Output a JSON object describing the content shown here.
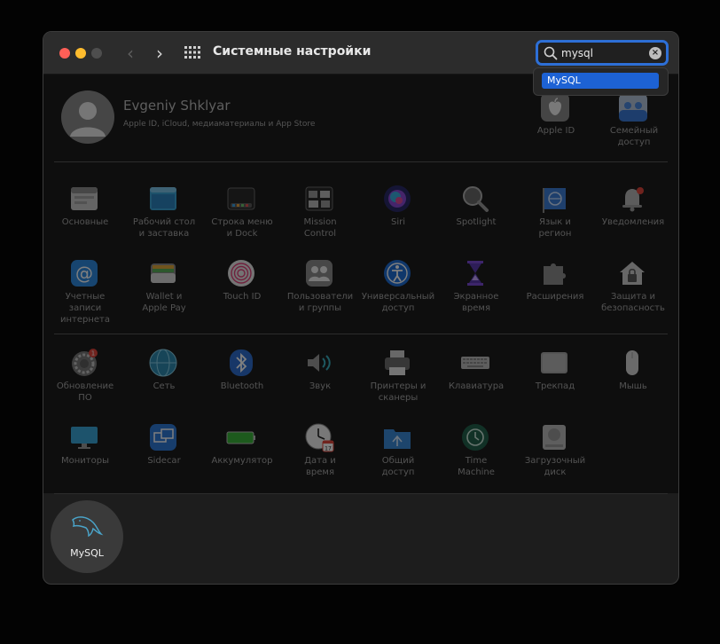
{
  "window": {
    "title": "Системные настройки"
  },
  "search": {
    "value": "mysql",
    "suggestion": "MySQL"
  },
  "user": {
    "name": "Evgeniy Shklyar",
    "subtitle": "Apple ID, iCloud, медиаматериалы и App Store"
  },
  "top_panes": [
    {
      "label1": "Apple ID",
      "label2": "",
      "icon": "apple-icon"
    },
    {
      "label1": "Семейный",
      "label2": "доступ",
      "icon": "family-icon"
    }
  ],
  "rows": [
    [
      {
        "label1": "Основные",
        "label2": "",
        "icon": "general-icon"
      },
      {
        "label1": "Рабочий стол",
        "label2": "и заставка",
        "icon": "desktop-icon"
      },
      {
        "label1": "Строка меню",
        "label2": "и Dock",
        "icon": "dock-icon"
      },
      {
        "label1": "Mission",
        "label2": "Control",
        "icon": "mission-control-icon"
      },
      {
        "label1": "Siri",
        "label2": "",
        "icon": "siri-icon"
      },
      {
        "label1": "Spotlight",
        "label2": "",
        "icon": "spotlight-icon"
      },
      {
        "label1": "Язык и",
        "label2": "регион",
        "icon": "language-region-icon"
      },
      {
        "label1": "Уведомления",
        "label2": "",
        "icon": "notifications-icon"
      }
    ],
    [
      {
        "label1": "Учетные",
        "label2": "записи интернета",
        "icon": "internet-accounts-icon"
      },
      {
        "label1": "Wallet и",
        "label2": "Apple Pay",
        "icon": "wallet-icon"
      },
      {
        "label1": "Touch ID",
        "label2": "",
        "icon": "touch-id-icon"
      },
      {
        "label1": "Пользователи",
        "label2": "и группы",
        "icon": "users-groups-icon"
      },
      {
        "label1": "Универсальный",
        "label2": "доступ",
        "icon": "accessibility-icon"
      },
      {
        "label1": "Экранное",
        "label2": "время",
        "icon": "screen-time-icon"
      },
      {
        "label1": "Расширения",
        "label2": "",
        "icon": "extensions-icon"
      },
      {
        "label1": "Защита и",
        "label2": "безопасность",
        "icon": "security-icon"
      }
    ],
    [
      {
        "label1": "Обновление",
        "label2": "ПО",
        "icon": "software-update-icon",
        "badge": "1"
      },
      {
        "label1": "Сеть",
        "label2": "",
        "icon": "network-icon"
      },
      {
        "label1": "Bluetooth",
        "label2": "",
        "icon": "bluetooth-icon"
      },
      {
        "label1": "Звук",
        "label2": "",
        "icon": "sound-icon"
      },
      {
        "label1": "Принтеры и",
        "label2": "сканеры",
        "icon": "printers-icon"
      },
      {
        "label1": "Клавиатура",
        "label2": "",
        "icon": "keyboard-icon"
      },
      {
        "label1": "Трекпад",
        "label2": "",
        "icon": "trackpad-icon"
      },
      {
        "label1": "Мышь",
        "label2": "",
        "icon": "mouse-icon"
      }
    ],
    [
      {
        "label1": "Мониторы",
        "label2": "",
        "icon": "displays-icon"
      },
      {
        "label1": "Sidecar",
        "label2": "",
        "icon": "sidecar-icon"
      },
      {
        "label1": "Аккумулятор",
        "label2": "",
        "icon": "battery-icon"
      },
      {
        "label1": "Дата и",
        "label2": "время",
        "icon": "date-time-icon",
        "day": "17"
      },
      {
        "label1": "Общий",
        "label2": "доступ",
        "icon": "sharing-icon"
      },
      {
        "label1": "Time",
        "label2": "Machine",
        "icon": "time-machine-icon"
      },
      {
        "label1": "Загрузочный",
        "label2": "диск",
        "icon": "startup-disk-icon"
      }
    ]
  ],
  "third_party": {
    "label": "MySQL",
    "icon": "mysql-dolphin-icon"
  }
}
